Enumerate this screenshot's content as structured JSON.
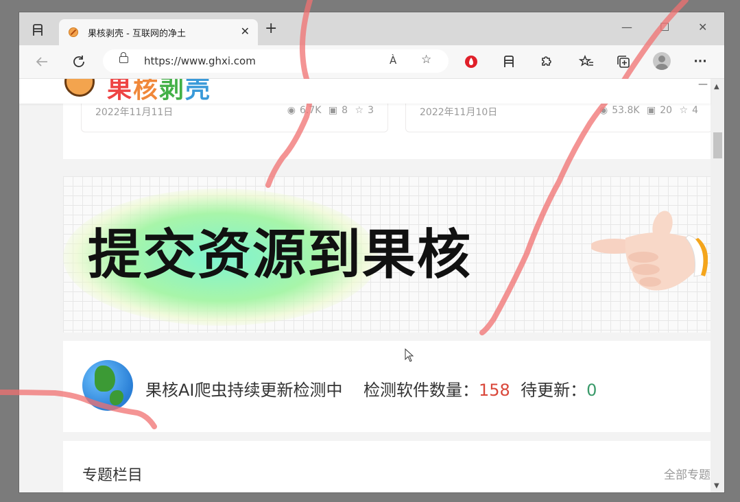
{
  "browser": {
    "tab_title": "果核剥壳 - 互联网的净土",
    "close_glyph": "✕",
    "new_tab_glyph": "+",
    "minimize_glyph": "—",
    "maximize_glyph": "☐",
    "window_close_glyph": "✕",
    "url": "https://www.ghxi.com",
    "read_aloud_glyph": "À",
    "more_glyph": "···"
  },
  "page": {
    "logo_chars": [
      "果",
      "核",
      "剥",
      "壳"
    ],
    "cards": [
      {
        "date": "2022年11月11日",
        "views": "6.7K",
        "comments": "8",
        "stars": "3"
      },
      {
        "date": "2022年11月10日",
        "views": "53.8K",
        "comments": "20",
        "stars": "4"
      }
    ],
    "banner_text": "提交资源到果核",
    "monitor": {
      "label": "果核AI爬虫持续更新检测中",
      "count_label": "检测软件数量：",
      "count_value": "158",
      "pending_label": "待更新：",
      "pending_value": "0"
    },
    "section": {
      "title": "专题栏目",
      "more": "全部专题"
    }
  },
  "colors": {
    "accent_red": "#d9473a",
    "accent_green": "#3a9a6a",
    "annotation_ink": "#f07070"
  }
}
